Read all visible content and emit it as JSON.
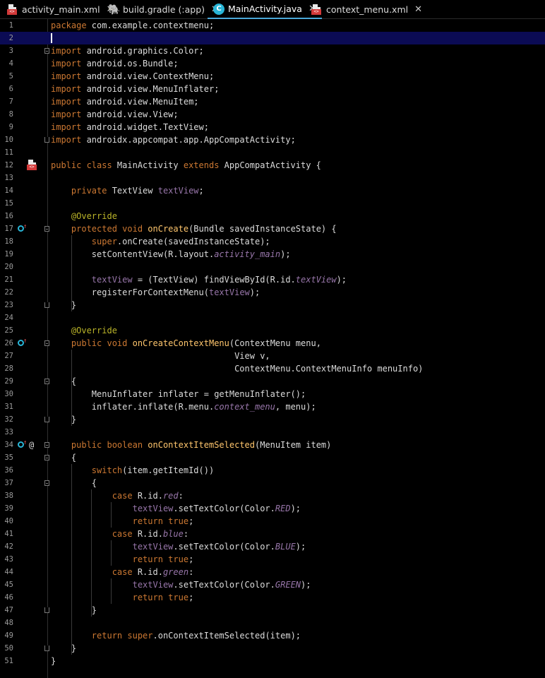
{
  "tabs": [
    {
      "label": "activity_main.xml",
      "icon": "xml-file-icon",
      "active": false
    },
    {
      "label": "build.gradle (:app)",
      "icon": "gradle-icon",
      "active": false
    },
    {
      "label": "MainActivity.java",
      "icon": "java-class-icon",
      "icon_letter": "C",
      "active": true
    },
    {
      "label": "context_menu.xml",
      "icon": "xml-file-icon",
      "active": false
    }
  ],
  "close_glyph": "✕",
  "xml_icon_text": "<>",
  "gutter": {
    "at_symbol": "@",
    "override_arrow": "↑"
  },
  "colors": {
    "background": "#000000",
    "current_line": "#0b0b54",
    "keyword": "#cc7832",
    "method": "#ffc66d",
    "field": "#9876aa",
    "annotation": "#bbb529",
    "text": "#dcdcdc",
    "tab_underline": "#4aa8d8"
  },
  "current_line": 2,
  "lines": [
    {
      "n": "1",
      "tokens": [
        [
          "k",
          "package"
        ],
        [
          "p",
          " com.example.contextmenu;"
        ]
      ]
    },
    {
      "n": "2",
      "tokens": []
    },
    {
      "n": "3",
      "tokens": [
        [
          "k",
          "import"
        ],
        [
          "p",
          " android.graphics.Color;"
        ]
      ]
    },
    {
      "n": "4",
      "tokens": [
        [
          "k",
          "import"
        ],
        [
          "p",
          " android.os.Bundle;"
        ]
      ]
    },
    {
      "n": "5",
      "tokens": [
        [
          "k",
          "import"
        ],
        [
          "p",
          " android.view.ContextMenu;"
        ]
      ]
    },
    {
      "n": "6",
      "tokens": [
        [
          "k",
          "import"
        ],
        [
          "p",
          " android.view.MenuInflater;"
        ]
      ]
    },
    {
      "n": "7",
      "tokens": [
        [
          "k",
          "import"
        ],
        [
          "p",
          " android.view.MenuItem;"
        ]
      ]
    },
    {
      "n": "8",
      "tokens": [
        [
          "k",
          "import"
        ],
        [
          "p",
          " android.view.View;"
        ]
      ]
    },
    {
      "n": "9",
      "tokens": [
        [
          "k",
          "import"
        ],
        [
          "p",
          " android.widget.TextView;"
        ]
      ]
    },
    {
      "n": "10",
      "tokens": [
        [
          "k",
          "import"
        ],
        [
          "p",
          " androidx.appcompat.app.AppCompatActivity;"
        ]
      ]
    },
    {
      "n": "11",
      "tokens": []
    },
    {
      "n": "12",
      "tokens": [
        [
          "k",
          "public class "
        ],
        [
          "p",
          "MainActivity "
        ],
        [
          "k",
          "extends "
        ],
        [
          "p",
          "AppCompatActivity {"
        ]
      ]
    },
    {
      "n": "13",
      "tokens": []
    },
    {
      "n": "14",
      "tokens": [
        [
          "p",
          "    "
        ],
        [
          "k",
          "private "
        ],
        [
          "p",
          "TextView "
        ],
        [
          "fi",
          "textView"
        ],
        [
          "p",
          ";"
        ]
      ]
    },
    {
      "n": "15",
      "tokens": []
    },
    {
      "n": "16",
      "tokens": [
        [
          "p",
          "    "
        ],
        [
          "an",
          "@Override"
        ]
      ]
    },
    {
      "n": "17",
      "tokens": [
        [
          "p",
          "    "
        ],
        [
          "k",
          "protected void "
        ],
        [
          "f",
          "onCreate"
        ],
        [
          "p",
          "(Bundle savedInstanceState) {"
        ]
      ]
    },
    {
      "n": "18",
      "tokens": [
        [
          "p",
          "        "
        ],
        [
          "k",
          "super"
        ],
        [
          "p",
          ".onCreate(savedInstanceState);"
        ]
      ]
    },
    {
      "n": "19",
      "tokens": [
        [
          "p",
          "        setContentView(R.layout."
        ],
        [
          "fit",
          "activity_main"
        ],
        [
          "p",
          ");"
        ]
      ]
    },
    {
      "n": "20",
      "tokens": []
    },
    {
      "n": "21",
      "tokens": [
        [
          "p",
          "        "
        ],
        [
          "fi",
          "textView"
        ],
        [
          "p",
          " = (TextView) findViewById(R.id."
        ],
        [
          "fit",
          "textView"
        ],
        [
          "p",
          ");"
        ]
      ]
    },
    {
      "n": "22",
      "tokens": [
        [
          "p",
          "        registerForContextMenu("
        ],
        [
          "fi",
          "textView"
        ],
        [
          "p",
          ");"
        ]
      ]
    },
    {
      "n": "23",
      "tokens": [
        [
          "p",
          "    }"
        ]
      ]
    },
    {
      "n": "24",
      "tokens": []
    },
    {
      "n": "25",
      "tokens": [
        [
          "p",
          "    "
        ],
        [
          "an",
          "@Override"
        ]
      ]
    },
    {
      "n": "26",
      "tokens": [
        [
          "p",
          "    "
        ],
        [
          "k",
          "public void "
        ],
        [
          "f",
          "onCreateContextMenu"
        ],
        [
          "p",
          "(ContextMenu menu,"
        ]
      ]
    },
    {
      "n": "27",
      "tokens": [
        [
          "p",
          "                                    View v,"
        ]
      ]
    },
    {
      "n": "28",
      "tokens": [
        [
          "p",
          "                                    ContextMenu.ContextMenuInfo menuInfo)"
        ]
      ]
    },
    {
      "n": "29",
      "tokens": [
        [
          "p",
          "    {"
        ]
      ]
    },
    {
      "n": "30",
      "tokens": [
        [
          "p",
          "        MenuInflater inflater = getMenuInflater();"
        ]
      ]
    },
    {
      "n": "31",
      "tokens": [
        [
          "p",
          "        inflater.inflate(R.menu."
        ],
        [
          "fit",
          "context_menu"
        ],
        [
          "p",
          ", menu);"
        ]
      ]
    },
    {
      "n": "32",
      "tokens": [
        [
          "p",
          "    }"
        ]
      ]
    },
    {
      "n": "33",
      "tokens": []
    },
    {
      "n": "34",
      "tokens": [
        [
          "p",
          "    "
        ],
        [
          "k",
          "public boolean "
        ],
        [
          "f",
          "onContextItemSelected"
        ],
        [
          "p",
          "(MenuItem item)"
        ]
      ]
    },
    {
      "n": "35",
      "tokens": [
        [
          "p",
          "    {"
        ]
      ]
    },
    {
      "n": "36",
      "tokens": [
        [
          "p",
          "        "
        ],
        [
          "k",
          "switch"
        ],
        [
          "p",
          "(item.getItemId())"
        ]
      ]
    },
    {
      "n": "37",
      "tokens": [
        [
          "p",
          "        {"
        ]
      ]
    },
    {
      "n": "38",
      "tokens": [
        [
          "p",
          "            "
        ],
        [
          "k",
          "case "
        ],
        [
          "p",
          "R.id."
        ],
        [
          "fit",
          "red"
        ],
        [
          "p",
          ":"
        ]
      ]
    },
    {
      "n": "39",
      "tokens": [
        [
          "p",
          "                "
        ],
        [
          "fi",
          "textView"
        ],
        [
          "p",
          ".setTextColor(Color."
        ],
        [
          "fit",
          "RED"
        ],
        [
          "p",
          ");"
        ]
      ]
    },
    {
      "n": "40",
      "tokens": [
        [
          "p",
          "                "
        ],
        [
          "k",
          "return true"
        ],
        [
          "p",
          ";"
        ]
      ]
    },
    {
      "n": "41",
      "tokens": [
        [
          "p",
          "            "
        ],
        [
          "k",
          "case "
        ],
        [
          "p",
          "R.id."
        ],
        [
          "fit",
          "blue"
        ],
        [
          "p",
          ":"
        ]
      ]
    },
    {
      "n": "42",
      "tokens": [
        [
          "p",
          "                "
        ],
        [
          "fi",
          "textView"
        ],
        [
          "p",
          ".setTextColor(Color."
        ],
        [
          "fit",
          "BLUE"
        ],
        [
          "p",
          ");"
        ]
      ]
    },
    {
      "n": "43",
      "tokens": [
        [
          "p",
          "                "
        ],
        [
          "k",
          "return true"
        ],
        [
          "p",
          ";"
        ]
      ]
    },
    {
      "n": "44",
      "tokens": [
        [
          "p",
          "            "
        ],
        [
          "k",
          "case "
        ],
        [
          "p",
          "R.id."
        ],
        [
          "fit",
          "green"
        ],
        [
          "p",
          ":"
        ]
      ]
    },
    {
      "n": "45",
      "tokens": [
        [
          "p",
          "                "
        ],
        [
          "fi",
          "textView"
        ],
        [
          "p",
          ".setTextColor(Color."
        ],
        [
          "fit",
          "GREEN"
        ],
        [
          "p",
          ");"
        ]
      ]
    },
    {
      "n": "46",
      "tokens": [
        [
          "p",
          "                "
        ],
        [
          "k",
          "return true"
        ],
        [
          "p",
          ";"
        ]
      ]
    },
    {
      "n": "47",
      "tokens": [
        [
          "p",
          "        }"
        ]
      ]
    },
    {
      "n": "48",
      "tokens": []
    },
    {
      "n": "49",
      "tokens": [
        [
          "p",
          "        "
        ],
        [
          "k",
          "return super"
        ],
        [
          "p",
          ".onContextItemSelected(item);"
        ]
      ]
    },
    {
      "n": "50",
      "tokens": [
        [
          "p",
          "    }"
        ]
      ]
    },
    {
      "n": "51",
      "tokens": [
        [
          "p",
          "}"
        ]
      ]
    }
  ]
}
